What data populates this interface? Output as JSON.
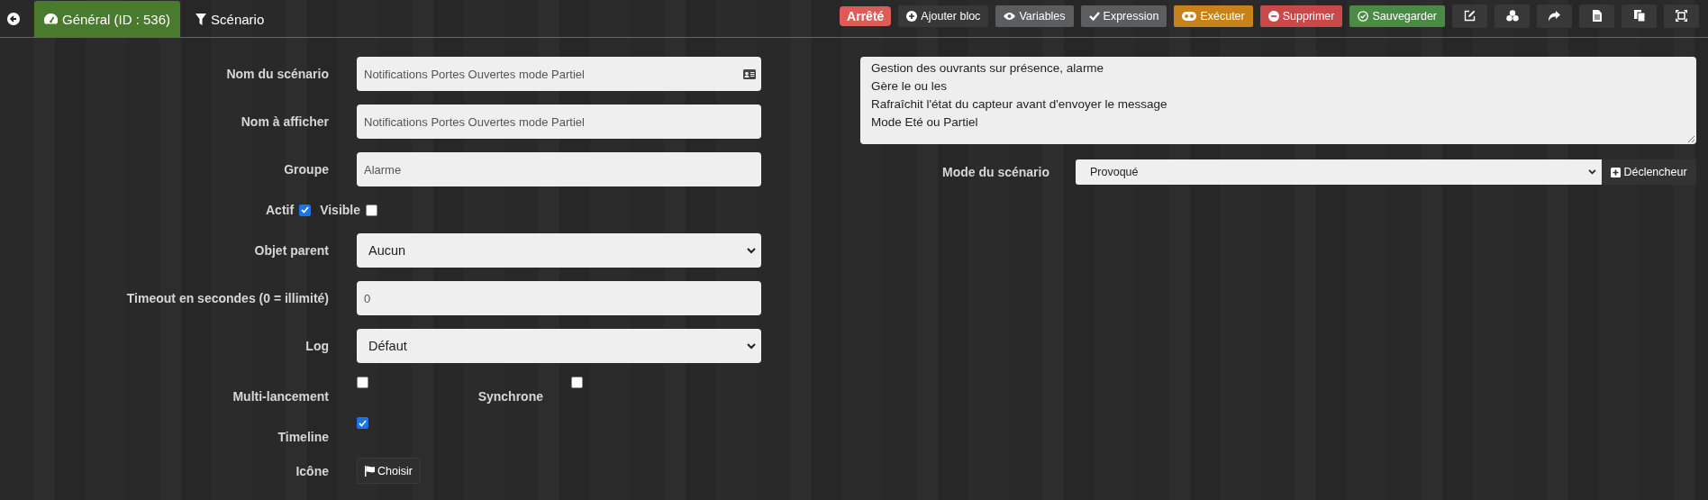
{
  "tabs": [
    {
      "label": "Général (ID : 536)",
      "selected": true
    },
    {
      "label": "Scénario",
      "selected": false
    }
  ],
  "status_badge": "Arrêté",
  "toolbar": [
    {
      "label": "Ajouter bloc",
      "kind": "dark"
    },
    {
      "label": "Variables",
      "kind": "grey"
    },
    {
      "label": "Expression",
      "kind": "grey"
    },
    {
      "label": "Exécuter",
      "kind": "orange"
    },
    {
      "label": "Supprimer",
      "kind": "red"
    },
    {
      "label": "Sauvegarder",
      "kind": "green"
    }
  ],
  "form": [
    {
      "kind": "text",
      "label": "Nom du scénario",
      "value": "Notifications Portes Ouvertes mode Partiel"
    },
    {
      "kind": "text",
      "label": "Nom à afficher",
      "value": "Notifications Portes Ouvertes mode Partiel"
    },
    {
      "kind": "text",
      "label": "Groupe",
      "value": "Alarme"
    },
    {
      "kind": "checks",
      "items": [
        {
          "label": "Actif",
          "checked": true
        },
        {
          "label": "Visible",
          "checked": false
        }
      ]
    },
    {
      "kind": "select",
      "label": "Objet parent",
      "value": "Aucun"
    },
    {
      "kind": "text",
      "label": "Timeout en secondes (0 = illimité)",
      "value": "0"
    },
    {
      "kind": "select",
      "label": "Log",
      "value": "Défaut"
    },
    {
      "kind": "pair",
      "items": [
        {
          "label": "Multi-lancement",
          "checked": false
        },
        {
          "label": "Synchrone",
          "checked": false
        }
      ]
    },
    {
      "kind": "check",
      "label": "Timeline",
      "checked": true
    },
    {
      "kind": "button",
      "label": "Icône",
      "value": "Choisir"
    }
  ],
  "description": [
    "Gestion des ouvrants sur présence, alarme",
    "Gère le ou les",
    "Rafraîchit l'état du capteur avant d'envoyer le message",
    "Mode Eté ou Partiel"
  ],
  "mode": {
    "label": "Mode du scénario",
    "value": "Provoqué",
    "button": "Déclencheur"
  }
}
